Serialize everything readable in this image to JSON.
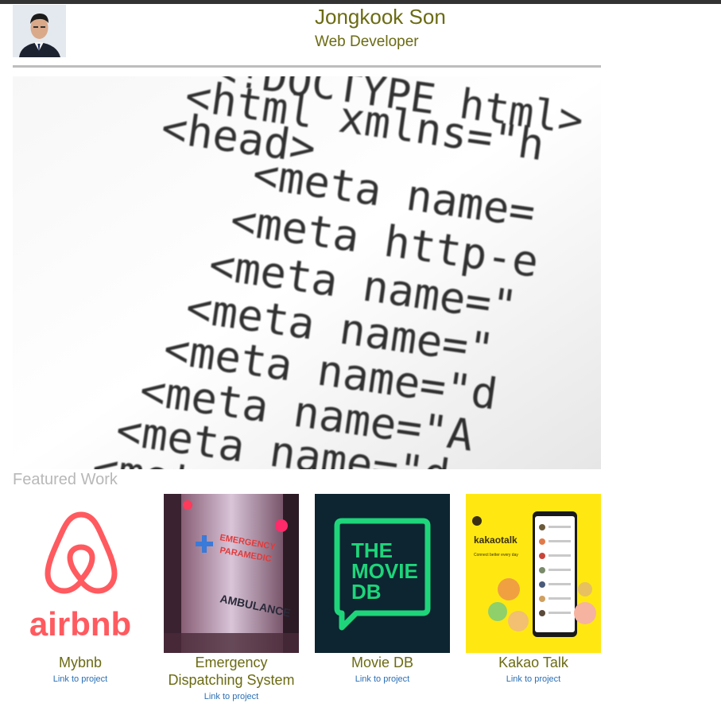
{
  "header": {
    "name": "Jongkook Son",
    "role": "Web Developer"
  },
  "hero": {
    "code_lines": [
      "<!DOCTYPE html>",
      "<html xmlns=\"h",
      "<head>",
      "<meta name=",
      "<meta http-e",
      "<meta name=\"",
      "<meta name=\"",
      "<meta name=\"d",
      "<meta name=\"A",
      "<meta name=\"d",
      "<meta n"
    ]
  },
  "featured": {
    "title": "Featured Work",
    "projects": [
      {
        "title": "Mybnb",
        "link": "Link to project",
        "logo_text": "airbnb"
      },
      {
        "title": "Emergency Dispatching System",
        "link": "Link to project",
        "logo_text_1": "EMERGENCY",
        "logo_text_2": "PARAMEDIC",
        "logo_text_3": "AMBULANCE"
      },
      {
        "title": "Movie DB",
        "link": "Link to project",
        "logo_text_1": "THE",
        "logo_text_2": "MOVIE",
        "logo_text_3": "DB"
      },
      {
        "title": "Kakao Talk",
        "link": "Link to project",
        "logo_text": "kakaotalk",
        "logo_sub": "Connect better every day"
      }
    ]
  },
  "colors": {
    "accent_text": "#6b6b14",
    "link": "#2a6fb5",
    "muted": "#b8b8b8",
    "airbnb": "#ff5a5f",
    "moviedb_green": "#1ed57a",
    "kakao_yellow": "#ffe812"
  }
}
